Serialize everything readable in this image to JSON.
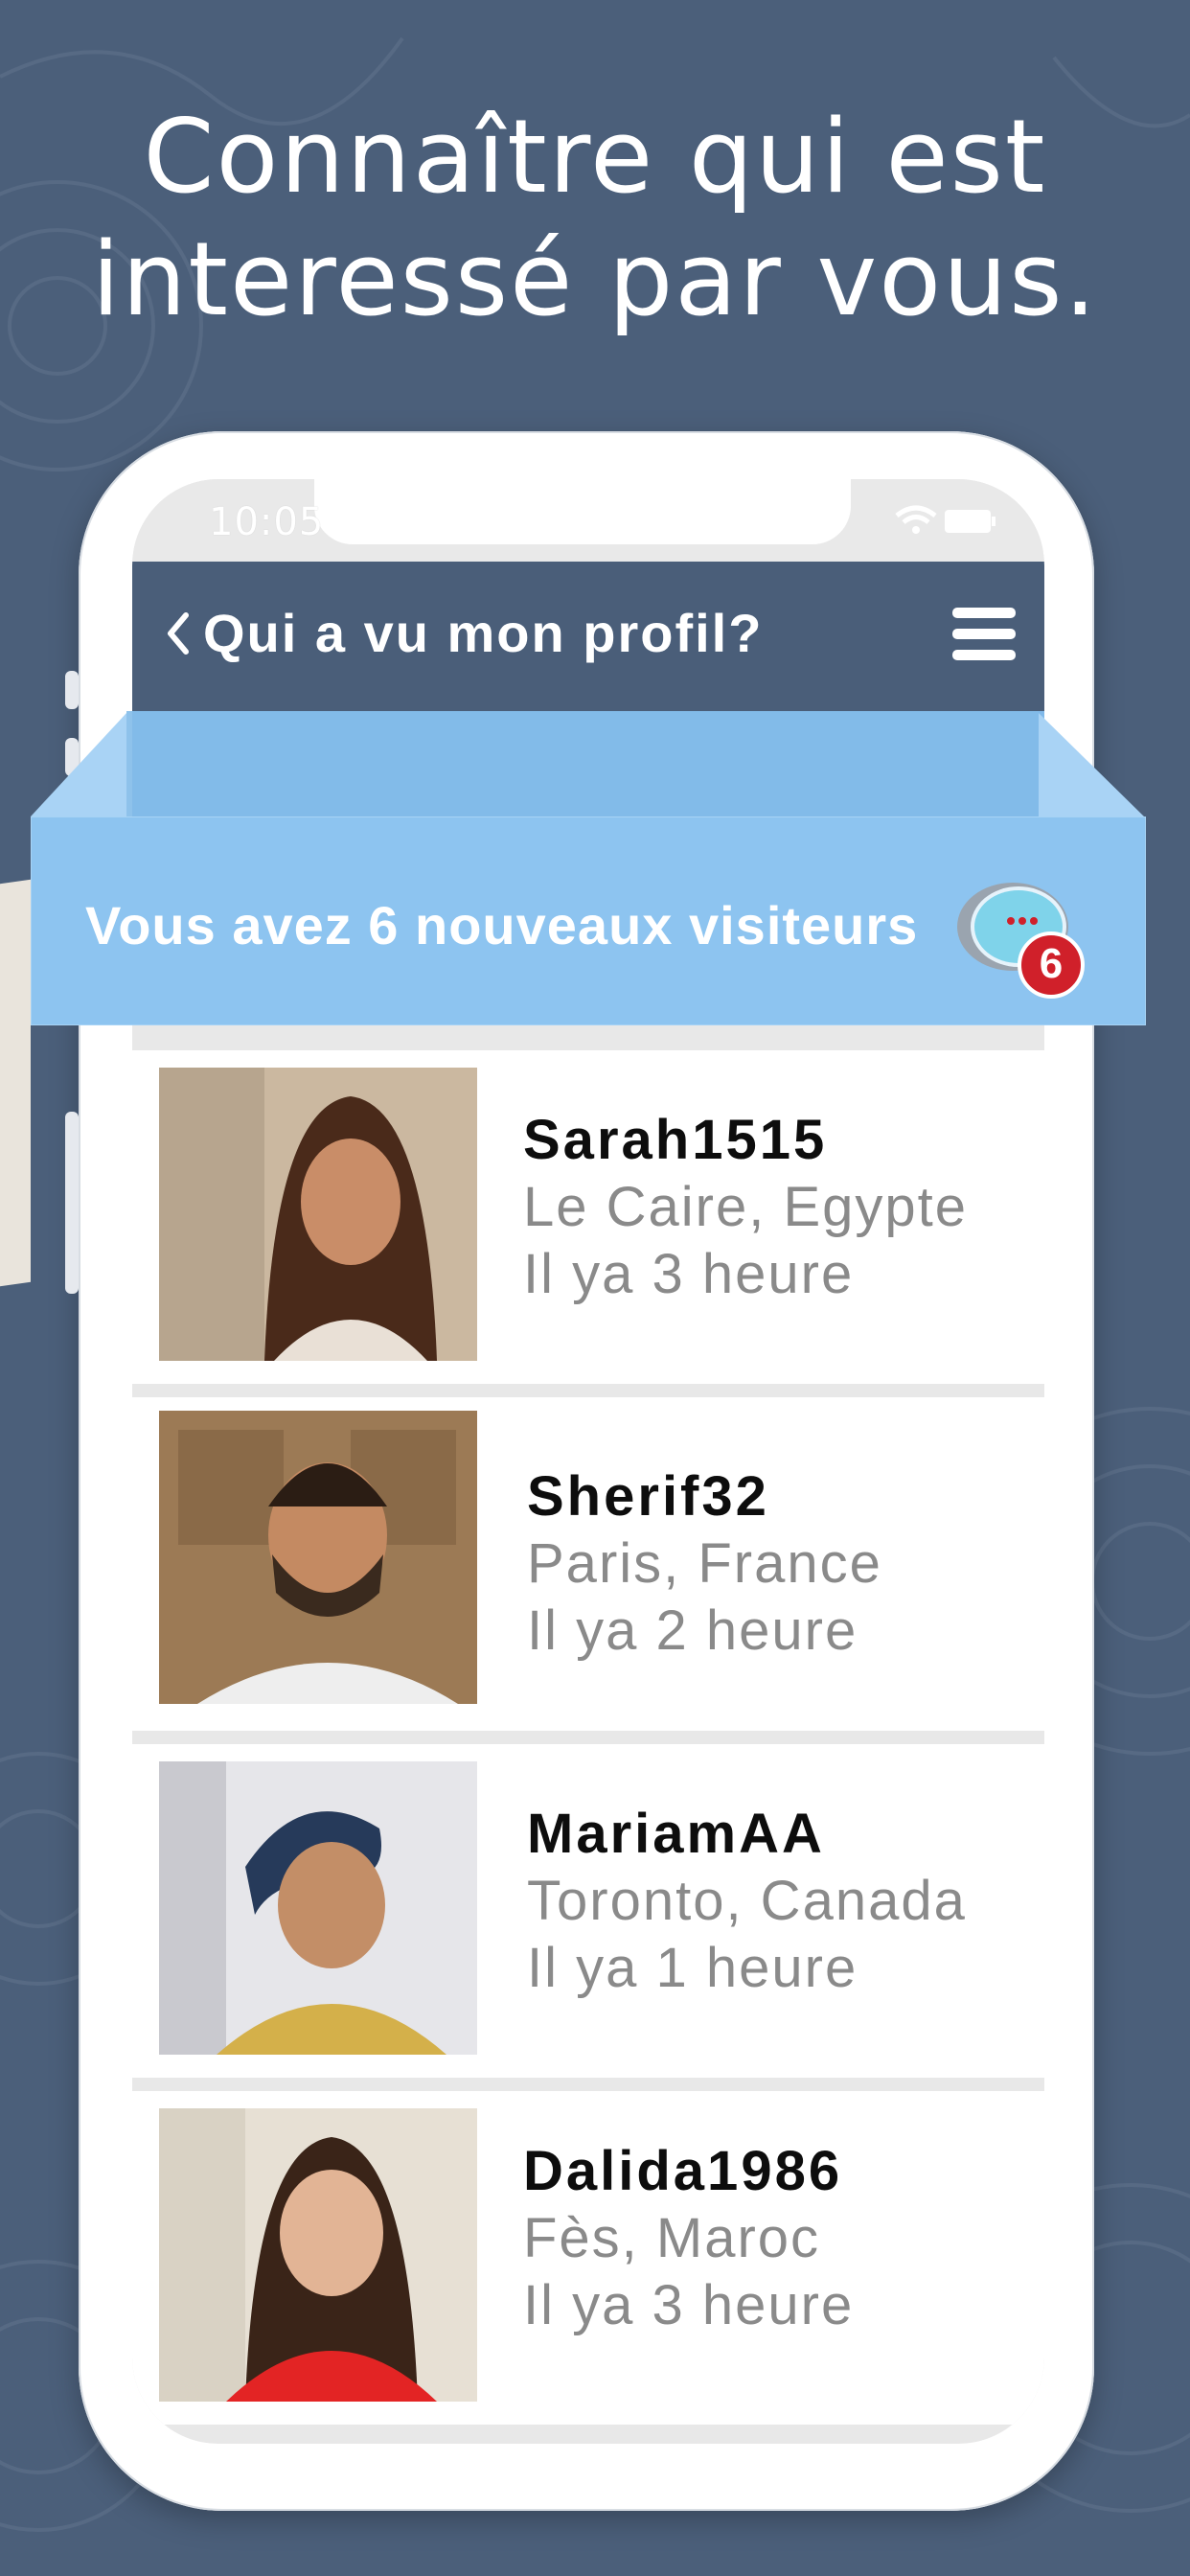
{
  "headline": {
    "line1": "Connaître qui est",
    "line2": "interessé par vous."
  },
  "statusbar": {
    "time": "10:05"
  },
  "header": {
    "title": "Qui a vu mon profil?"
  },
  "banner": {
    "text": "Vous avez 6 nouveaux visiteurs",
    "badge": "6"
  },
  "visitors": [
    {
      "username": "Sarah1515",
      "location": "Le Caire, Egypte",
      "time_ago": "Il ya 3 heure"
    },
    {
      "username": "Sherif32",
      "location": "Paris, France",
      "time_ago": "Il ya 2 heure"
    },
    {
      "username": "MariamAA",
      "location": "Toronto, Canada",
      "time_ago": "Il ya 1 heure"
    },
    {
      "username": "Dalida1986",
      "location": "Fès, Maroc",
      "time_ago": "Il ya 3 heure"
    }
  ],
  "colors": {
    "background": "#4b5f7a",
    "header": "#4a5e79",
    "banner": "#8dc4f0",
    "badge": "#d0202a"
  }
}
